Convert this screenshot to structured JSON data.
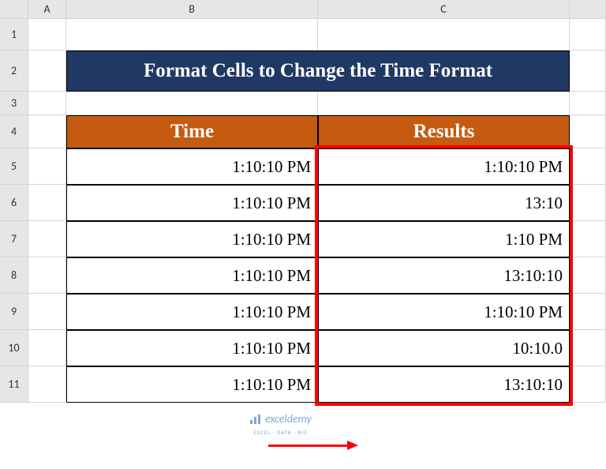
{
  "columns": [
    "A",
    "B",
    "C"
  ],
  "rows": [
    "1",
    "2",
    "3",
    "4",
    "5",
    "6",
    "7",
    "8",
    "9",
    "10",
    "11"
  ],
  "title": "Format Cells to Change the Time Format",
  "headers": {
    "time": "Time",
    "results": "Results"
  },
  "data": [
    {
      "time": "1:10:10 PM",
      "result": "1:10:10 PM"
    },
    {
      "time": "1:10:10 PM",
      "result": "13:10"
    },
    {
      "time": "1:10:10 PM",
      "result": "1:10 PM"
    },
    {
      "time": "1:10:10 PM",
      "result": "13:10:10"
    },
    {
      "time": "1:10:10 PM",
      "result": "1:10:10 PM"
    },
    {
      "time": "1:10:10 PM",
      "result": "10:10.0"
    },
    {
      "time": "1:10:10 PM",
      "result": "13:10:10"
    }
  ],
  "watermark": {
    "main": "exceldemy",
    "sub": "EXCEL · DATA · BIZ"
  },
  "chart_data": {
    "type": "table",
    "title": "Format Cells to Change the Time Format",
    "columns": [
      "Time",
      "Results"
    ],
    "rows": [
      [
        "1:10:10 PM",
        "1:10:10 PM"
      ],
      [
        "1:10:10 PM",
        "13:10"
      ],
      [
        "1:10:10 PM",
        "1:10 PM"
      ],
      [
        "1:10:10 PM",
        "13:10:10"
      ],
      [
        "1:10:10 PM",
        "1:10:10 PM"
      ],
      [
        "1:10:10 PM",
        "10:10.0"
      ],
      [
        "1:10:10 PM",
        "13:10:10"
      ]
    ]
  }
}
